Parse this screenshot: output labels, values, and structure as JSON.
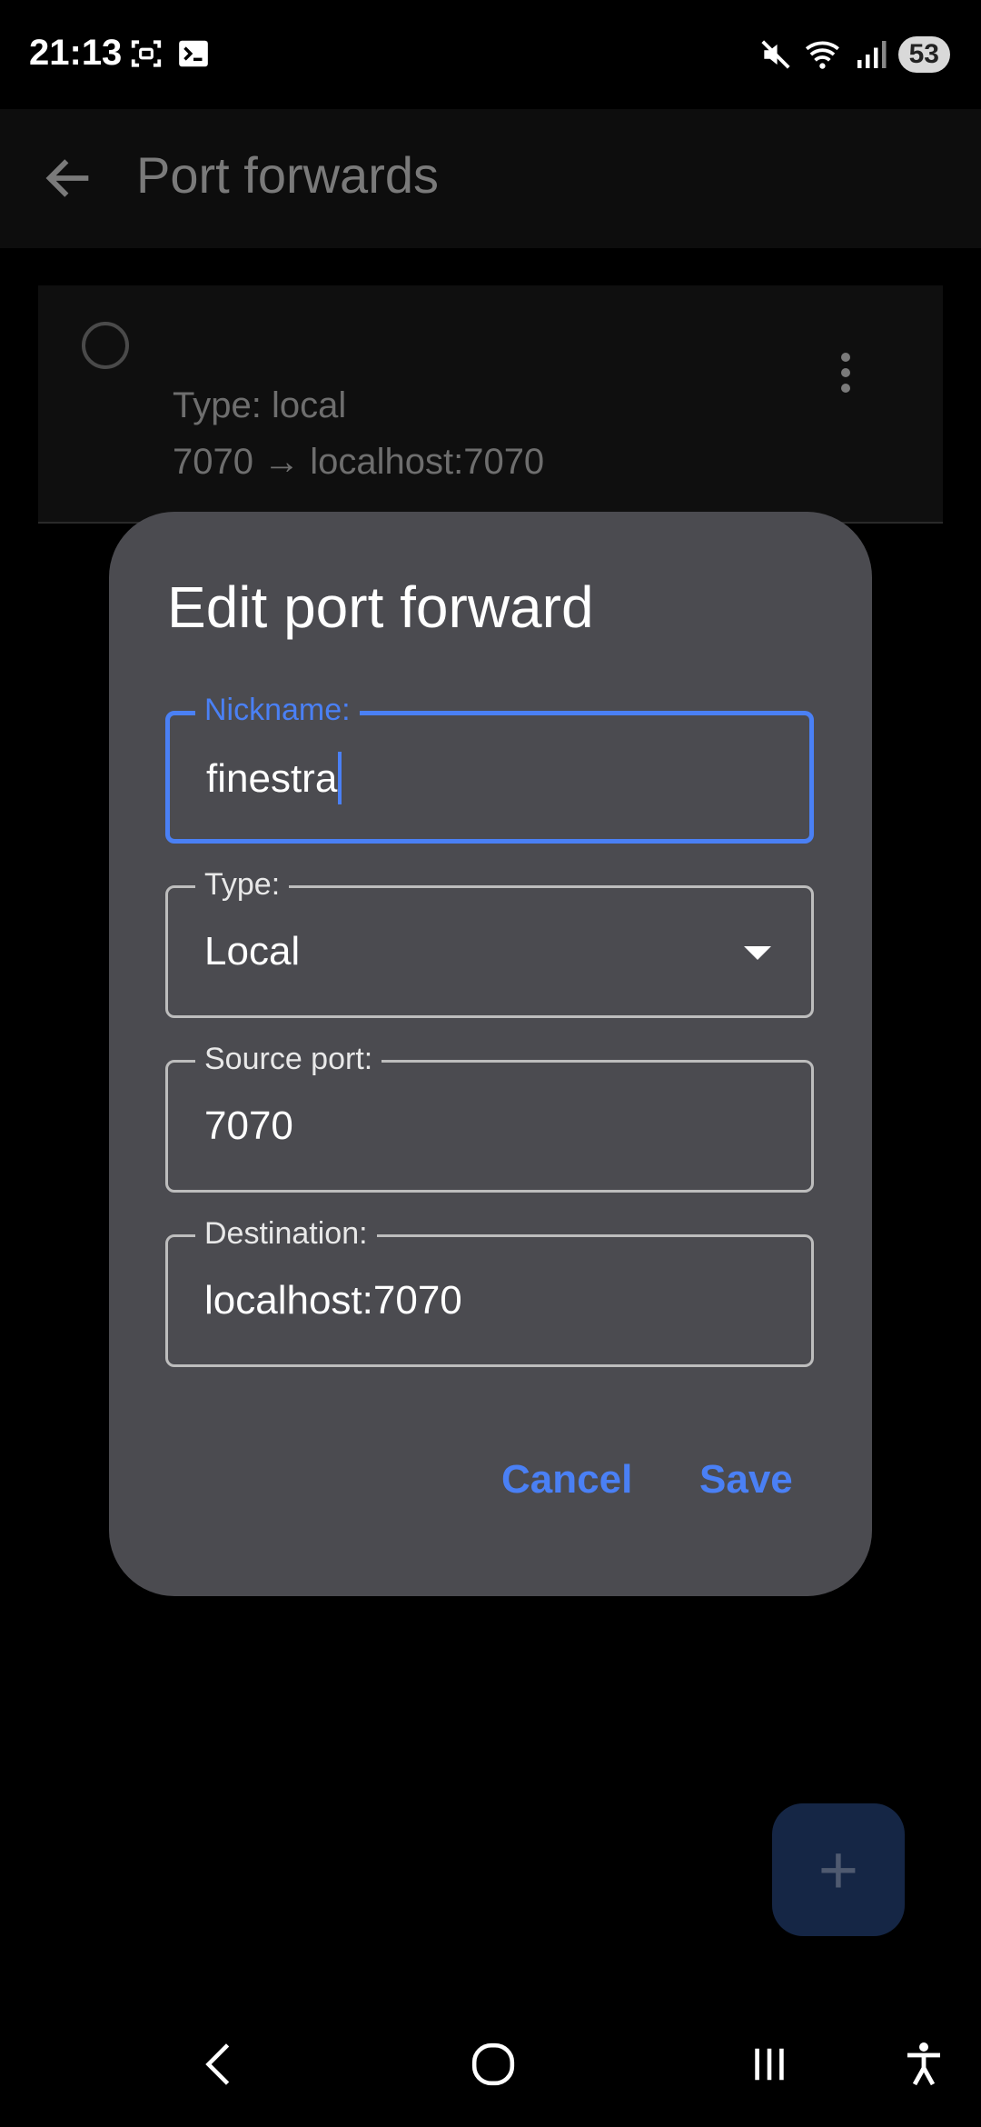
{
  "status_bar": {
    "time": "21:13",
    "battery": "53",
    "icons_left": [
      "screenshot-icon",
      "terminal-icon"
    ],
    "icons_right": [
      "mute-icon",
      "wifi-icon",
      "signal-icon"
    ]
  },
  "app_bar": {
    "title": "Port forwards"
  },
  "list": {
    "items": [
      {
        "type_text": "Type: local",
        "route_text": "7070 → localhost:7070"
      }
    ]
  },
  "dialog": {
    "title": "Edit port forward",
    "nickname": {
      "label": "Nickname:",
      "value": "finestra"
    },
    "type": {
      "label": "Type:",
      "value": "Local"
    },
    "source_port": {
      "label": "Source port:",
      "value": "7070"
    },
    "destination": {
      "label": "Destination:",
      "value": "localhost:7070"
    },
    "cancel_label": "Cancel",
    "save_label": "Save"
  },
  "fab": {
    "label": "+"
  },
  "colors": {
    "accent": "#4a80f5",
    "dialog_bg": "#4b4b50",
    "fab_bg": "#152645"
  }
}
